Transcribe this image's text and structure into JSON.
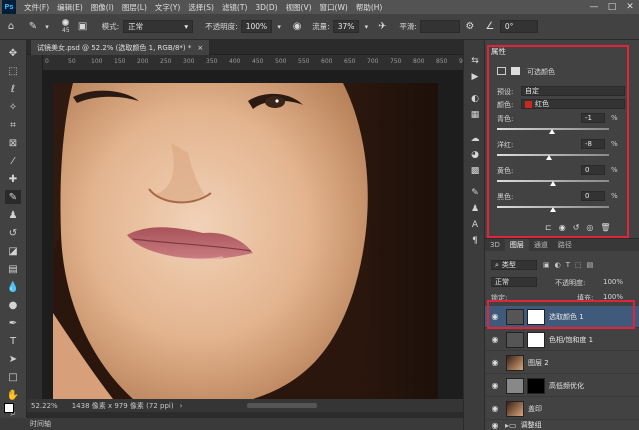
{
  "menu": {
    "app_logo": "Ps",
    "items": [
      "文件(F)",
      "编辑(E)",
      "图像(I)",
      "图层(L)",
      "文字(Y)",
      "选择(S)",
      "滤镜(T)",
      "3D(D)",
      "视图(V)",
      "窗口(W)",
      "帮助(H)"
    ],
    "win_min": "—",
    "win_max": "□",
    "win_close": "✕"
  },
  "options": {
    "brush_size": "45",
    "mode_label": "模式:",
    "mode_value": "正常",
    "opacity_label": "不透明度:",
    "opacity_value": "100%",
    "flow_label": "流量:",
    "flow_value": "37%",
    "smooth_label": "平滑:",
    "angle_value": "0°"
  },
  "document": {
    "tab_title": "试镜美女.psd @ 52.2% (选取颜色 1, RGB/8*) *",
    "close": "×"
  },
  "ruler": [
    "0",
    "50",
    "100",
    "150",
    "200",
    "250",
    "300",
    "350",
    "400",
    "450",
    "500",
    "550",
    "600",
    "650",
    "700",
    "750",
    "800",
    "850",
    "900"
  ],
  "status": {
    "zoom": "52.22%",
    "doc_info": "1438 像素 x 979 像素 (72 ppi)"
  },
  "timeline_label": "时间轴",
  "properties": {
    "title": "属性",
    "subtitle": "可选颜色",
    "preset_label": "预设:",
    "preset_value": "自定",
    "colors_label": "颜色:",
    "colors_value": "红色",
    "colors_swatch": "#c8281e",
    "sliders": [
      {
        "label": "青色:",
        "value": "-1",
        "unit": "%",
        "level": -1
      },
      {
        "label": "洋红:",
        "value": "-8",
        "unit": "%",
        "level": -8
      },
      {
        "label": "黄色:",
        "value": "0",
        "unit": "%",
        "level": 0
      },
      {
        "label": "黑色:",
        "value": "0",
        "unit": "%",
        "level": 0
      }
    ]
  },
  "layers": {
    "tabs": [
      "3D",
      "图层",
      "通道",
      "路径"
    ],
    "filter_label": "类型",
    "blend_mode": "正常",
    "opacity_label": "不透明度:",
    "opacity_value": "100%",
    "lock_label": "锁定:",
    "fill_label": "填充:",
    "fill_value": "100%",
    "items": [
      {
        "name": "选取颜色 1",
        "selected": true
      },
      {
        "name": "色相/饱和度 1",
        "selected": false
      },
      {
        "name": "图层 2",
        "selected": false
      },
      {
        "name": "高低频优化",
        "selected": false
      },
      {
        "name": "盖印",
        "selected": false
      },
      {
        "name": "调整组",
        "selected": false
      }
    ]
  },
  "accent_red": "#e0243a"
}
